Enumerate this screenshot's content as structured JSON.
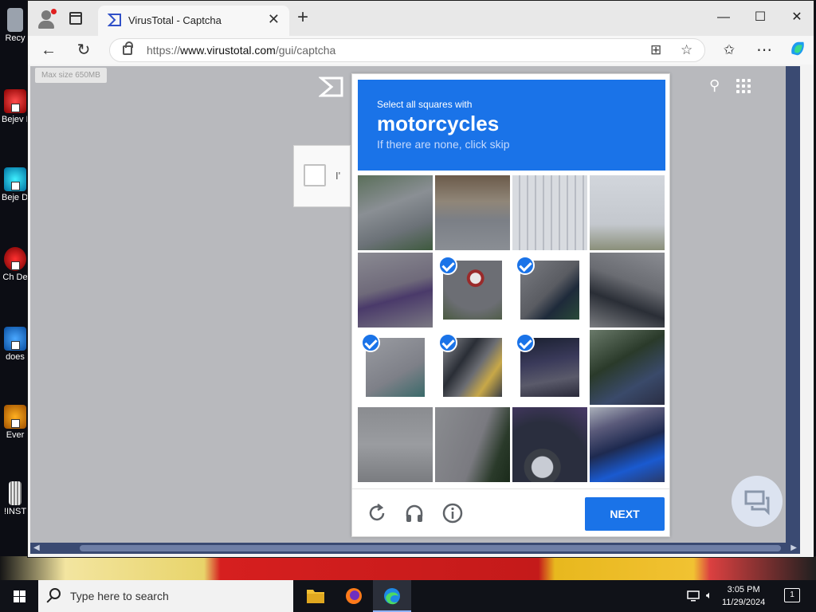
{
  "browser": {
    "tab_title": "VirusTotal - Captcha",
    "url_prefix": "https://",
    "url_domain": "www.virustotal.com",
    "url_path": "/gui/captcha"
  },
  "desktop": {
    "icons": [
      "Recy",
      "Bejev De",
      "Beje De",
      "Ch De",
      "does",
      "Ever",
      "!INST"
    ]
  },
  "page": {
    "max_size_label": "Max size 650MB",
    "checkbox_text": "I'"
  },
  "captcha": {
    "instruction": "Select all squares with",
    "keyword": "motorcycles",
    "subtext": "If there are none, click skip",
    "next_label": "NEXT",
    "selected_tiles": [
      5,
      6,
      8,
      9,
      10
    ]
  },
  "taskbar": {
    "search_placeholder": "Type here to search",
    "time": "3:05 PM",
    "date": "11/29/2024",
    "notification_count": "1"
  },
  "colors": {
    "accent": "#1a73e8"
  }
}
